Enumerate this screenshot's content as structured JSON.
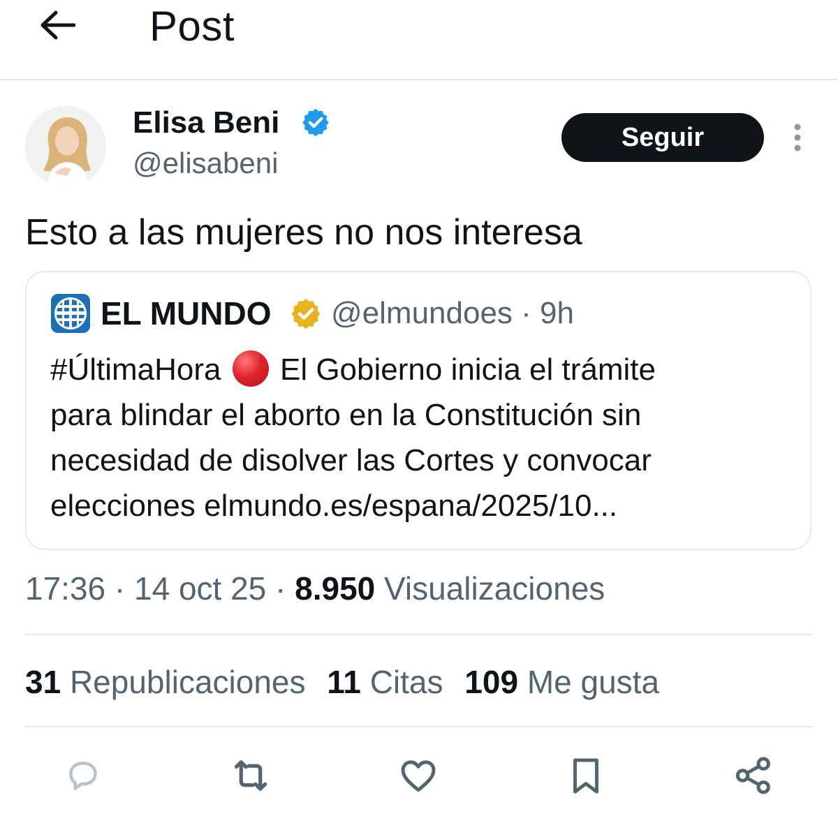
{
  "header": {
    "title": "Post",
    "back_icon": "arrow-left-icon"
  },
  "author": {
    "name": "Elisa Beni",
    "handle": "@elisabeni",
    "verified_color": "#1d9bf0"
  },
  "follow": {
    "label": "Seguir"
  },
  "tweet": {
    "text": "Esto a las mujeres no nos interesa"
  },
  "quote": {
    "name": "EL MUNDO",
    "handle_time": "@elmundoes · 9h",
    "badge_color": "#e8b21c",
    "lines": [
      "#ÚltimaHora",
      "El Gobierno inicia el trámite",
      "para blindar el aborto en la Constitución sin",
      "necesidad de disolver las Cortes y convocar",
      "elecciones  elmundo.es/espana/2025/10..."
    ]
  },
  "meta": {
    "time": "17:36 · 14 oct 25 · ",
    "views_count": "8.950",
    "views_label": " Visualizaciones"
  },
  "stats": {
    "reposts_count": "31",
    "reposts_label": " Republicaciones",
    "quotes_count": "11",
    "quotes_label": " Citas",
    "likes_count": "109",
    "likes_label": " Me gusta"
  },
  "actions": [
    "reply-icon",
    "repost-icon",
    "like-icon",
    "bookmark-icon",
    "share-icon"
  ],
  "colors": {
    "text": "#0f1419",
    "secondary": "#536471",
    "divider": "#e6e9ec",
    "action_icon": "#536471"
  }
}
